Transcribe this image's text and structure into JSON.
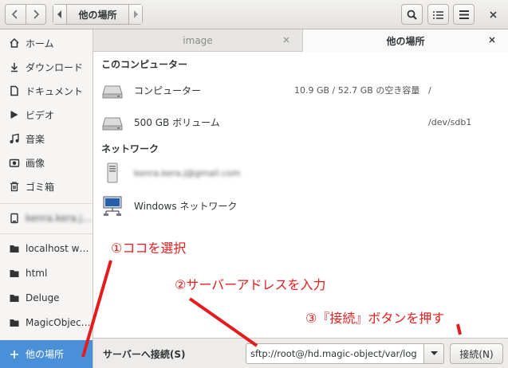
{
  "header": {
    "path_label": "他の場所",
    "icons": [
      "back-icon",
      "forward-icon",
      "path-left-icon",
      "path-right-icon",
      "search-icon",
      "view-list-icon",
      "menu-icon"
    ]
  },
  "sidebar": {
    "items": [
      {
        "label": "ホーム",
        "icon": "home-icon"
      },
      {
        "label": "ダウンロード",
        "icon": "download-icon"
      },
      {
        "label": "ドキュメント",
        "icon": "document-icon"
      },
      {
        "label": "ビデオ",
        "icon": "video-icon"
      },
      {
        "label": "音楽",
        "icon": "music-icon"
      },
      {
        "label": "画像",
        "icon": "camera-icon"
      },
      {
        "label": "ゴミ箱",
        "icon": "trash-icon"
      },
      {
        "label": "kenra.kera.j…",
        "icon": "drive-icon"
      },
      {
        "label": "localhost w…",
        "icon": "folder-icon"
      },
      {
        "label": "html",
        "icon": "folder-icon"
      },
      {
        "label": "Deluge",
        "icon": "folder-icon"
      },
      {
        "label": "MagicObjec…",
        "icon": "folder-icon"
      },
      {
        "label": "他の場所",
        "icon": "plus-icon"
      }
    ]
  },
  "tabs": [
    {
      "label": "image"
    },
    {
      "label": "他の場所"
    }
  ],
  "content": {
    "computer_section": "このコンピューター",
    "computer_rows": [
      {
        "name": "コンピューター",
        "info": "10.9 GB / 52.7 GB の空き容量",
        "path": "/"
      },
      {
        "name": "500 GB ボリューム",
        "info": "",
        "path": "/dev/sdb1"
      }
    ],
    "network_section": "ネットワーク",
    "network_rows": [
      {
        "name": "kenra.kera.j@gmail.com"
      },
      {
        "name": "Windows ネットワーク"
      }
    ]
  },
  "bottom": {
    "label": "サーバーへ接続(S)",
    "address_value": "sftp://root@/hd.magic-object/var/log",
    "connect_label": "接続(N)"
  },
  "annotations": {
    "step1": "①ココを選択",
    "step2": "②サーバーアドレスを入力",
    "step3": "③『接続』ボタンを押す",
    "color": "#e51c1c"
  }
}
